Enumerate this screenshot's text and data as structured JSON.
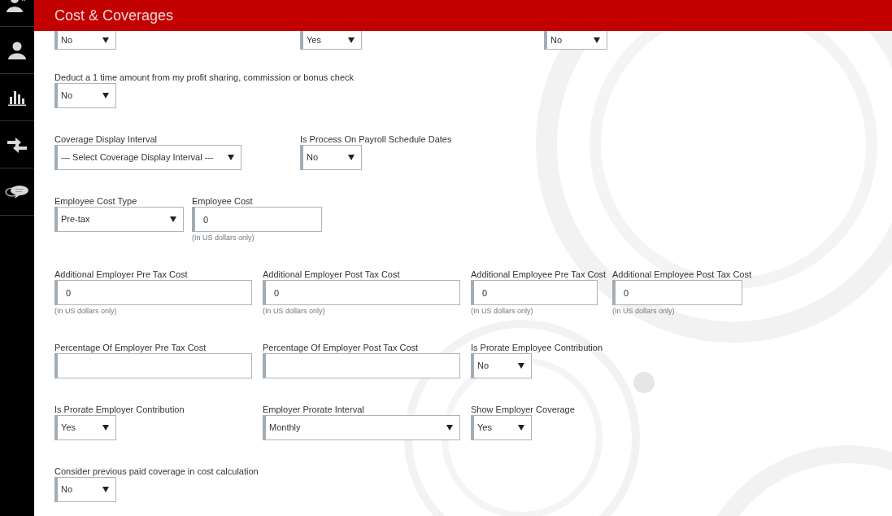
{
  "sidebar": {
    "items": [
      {
        "kind": "user-star"
      },
      {
        "kind": "user"
      },
      {
        "kind": "bar-chart"
      },
      {
        "kind": "transfer"
      },
      {
        "kind": "chat"
      }
    ]
  },
  "header": {
    "title": "Cost & Coverages"
  },
  "rows": [
    {
      "fields": [
        {
          "kind": "select",
          "value": "No"
        },
        {
          "kind": "select",
          "value": "Yes"
        },
        {
          "kind": "select",
          "value": "No"
        }
      ]
    },
    {
      "fields": [
        {
          "kind": "select",
          "label": "Deduct a 1 time amount from my profit sharing, commission or bonus check",
          "value": "No"
        }
      ]
    },
    {
      "fields": [
        {
          "kind": "select",
          "label": "Coverage Display Interval",
          "value": "--- Select Coverage Display Interval ---"
        },
        {
          "kind": "select",
          "label": "Is Process On Payroll Schedule Dates",
          "value": "No"
        }
      ]
    },
    {
      "fields": [
        {
          "kind": "select",
          "label": "Employee Cost Type",
          "value": "Pre-tax"
        },
        {
          "kind": "text",
          "label": "Employee Cost",
          "value": "0",
          "hint": "(In US dollars only)"
        }
      ]
    },
    {
      "fields": [
        {
          "kind": "text",
          "label": "Additional Employer Pre Tax Cost",
          "value": "0",
          "hint": "(In US dollars only)"
        },
        {
          "kind": "text",
          "label": "Additional Employer Post Tax Cost",
          "value": "0",
          "hint": "(In US dollars only)"
        },
        {
          "kind": "text",
          "label": "Additional Employee Pre Tax Cost",
          "value": "0",
          "hint": "(In US dollars only)"
        },
        {
          "kind": "text",
          "label": "Additional Employee Post Tax Cost",
          "value": "0",
          "hint": "(In US dollars only)"
        }
      ]
    },
    {
      "fields": [
        {
          "kind": "text",
          "label": "Percentage Of Employer Pre Tax Cost"
        },
        {
          "kind": "text",
          "label": "Percentage Of Employer Post Tax Cost"
        },
        {
          "kind": "select",
          "label": "Is Prorate Employee Contribution",
          "value": "No"
        }
      ]
    },
    {
      "fields": [
        {
          "kind": "select",
          "label": "Is Prorate Employer Contribution",
          "value": "Yes"
        },
        {
          "kind": "select",
          "label": "Employer Prorate Interval",
          "value": "Monthly"
        },
        {
          "kind": "select",
          "label": "Show Employer Coverage",
          "value": "Yes"
        }
      ]
    },
    {
      "fields": [
        {
          "kind": "select",
          "label": "Consider previous paid coverage in cost calculation",
          "value": "No"
        }
      ]
    }
  ]
}
